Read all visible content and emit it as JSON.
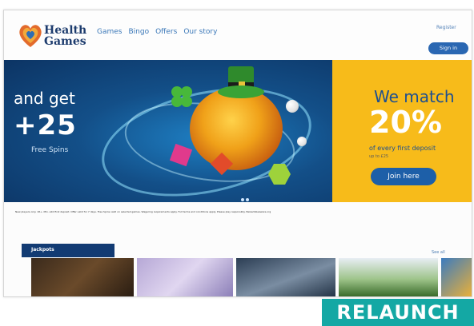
{
  "header": {
    "logo_line1": "Health",
    "logo_line2": "Games",
    "nav": [
      "Games",
      "Bingo",
      "Offers",
      "Our story"
    ],
    "register": "Register",
    "signin": "Sign in"
  },
  "hero": {
    "left_line1": "and get",
    "left_line2": "+25",
    "left_line3": "Free Spins",
    "right_line1": "We match",
    "right_line2": "20%",
    "right_line3": "of every first deposit",
    "right_line4": "up to £25",
    "join_button": "Join here"
  },
  "terms": "New players only. 18+. Min. £10 first deposit. Offer valid for 7 days. Free Spins valid on selected games. Wagering requirements apply. Full terms and conditions apply. Please play responsibly. BeGambleAware.org",
  "jackpots": {
    "title": "Jackpots",
    "see_all": "See all"
  },
  "label": "RELAUNCH",
  "colors": {
    "brand_blue": "#2a67b2",
    "hero_yellow": "#f7bb1a",
    "relaunch_teal": "#14a8a4"
  }
}
